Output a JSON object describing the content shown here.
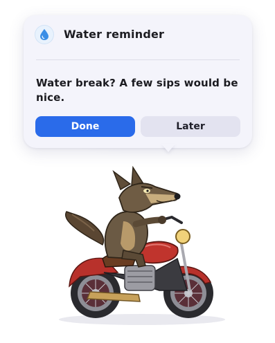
{
  "notification": {
    "title": "Water reminder",
    "icon": "water-drop-icon",
    "message": "Water break? A few sips would be nice.",
    "actions": {
      "done_label": "Done",
      "later_label": "Later"
    }
  },
  "colors": {
    "accent": "#2a6bea",
    "popup_background": "#f4f4fb",
    "secondary_button": "#e3e3f0",
    "drop_icon": "#3a8ee6"
  },
  "illustration": {
    "subject": "wolf-riding-motorcycle"
  }
}
